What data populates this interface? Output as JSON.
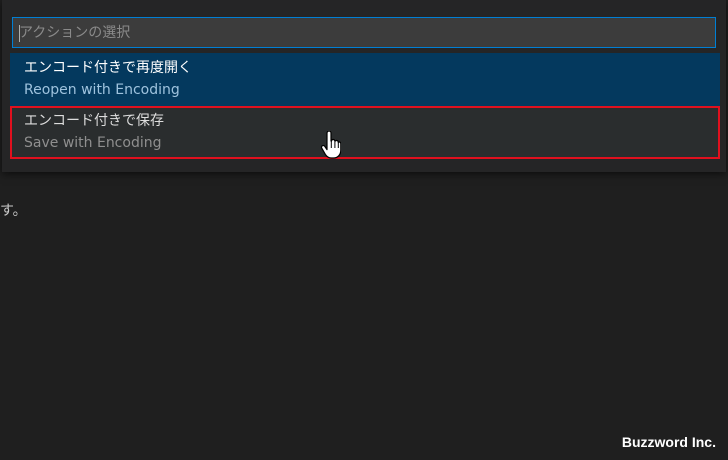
{
  "quick_pick": {
    "placeholder": "アクションの選択",
    "value": "",
    "items": [
      {
        "label": "エンコード付きで再度開く",
        "description": "Reopen with Encoding",
        "state": "focused"
      },
      {
        "label": "エンコード付きで保存",
        "description": "Save with Encoding",
        "state": "hovered"
      }
    ]
  },
  "editor": {
    "visible_text": "す。"
  },
  "annotation": {
    "highlight_color": "#e0101e"
  },
  "cursor": {
    "icon": "hand-pointer-icon"
  },
  "watermark": {
    "text": "Buzzword Inc."
  },
  "colors": {
    "background": "#1f1f1f",
    "input_border": "#007fd4",
    "focused_item": "#04395e",
    "hovered_item": "#2a2d2e"
  }
}
